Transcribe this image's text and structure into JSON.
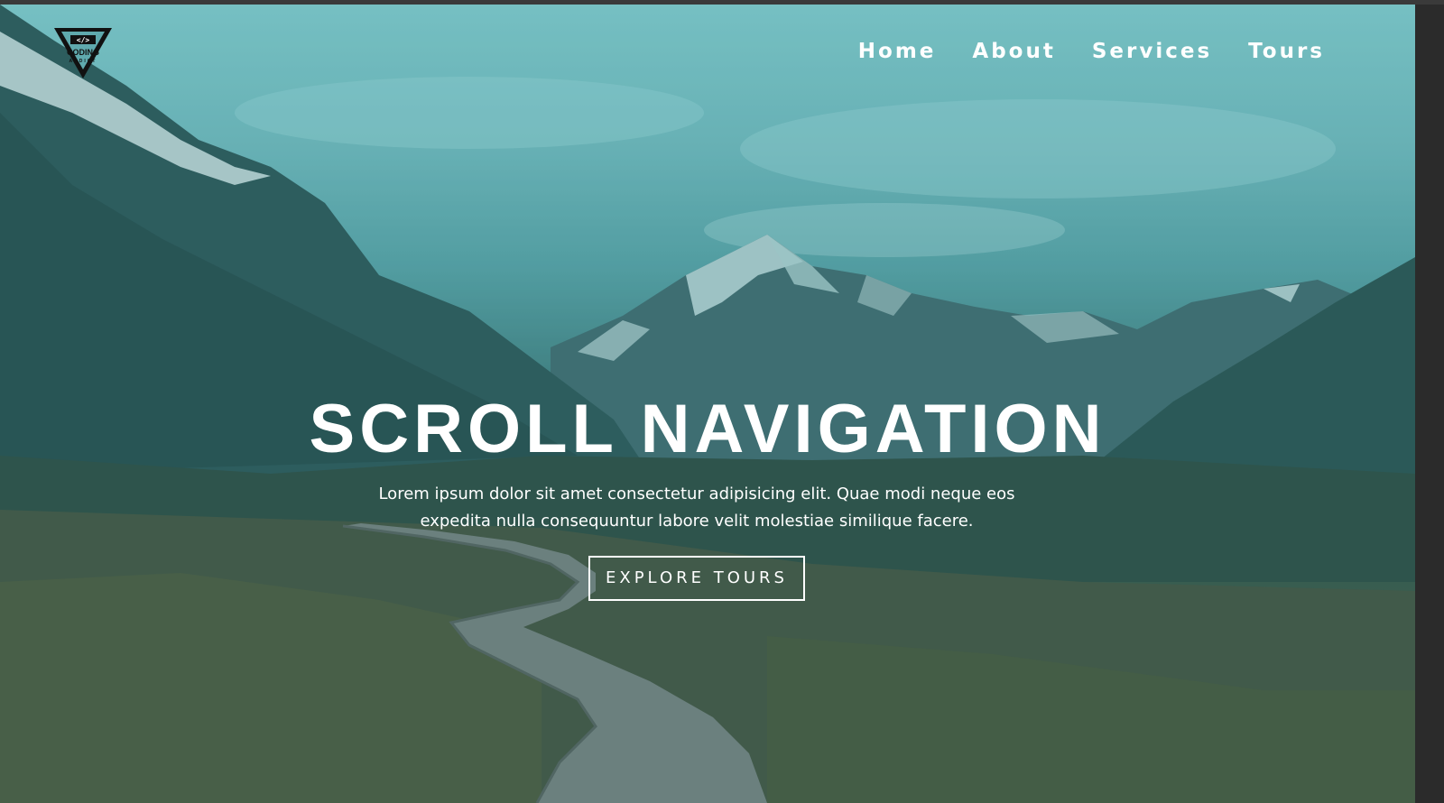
{
  "logo": {
    "text_main": "CODING",
    "text_sub": "ADDICT"
  },
  "nav": {
    "items": [
      {
        "label": "Home"
      },
      {
        "label": "About"
      },
      {
        "label": "Services"
      },
      {
        "label": "Tours"
      }
    ]
  },
  "hero": {
    "title": "SCROLL NAVIGATION",
    "description": "Lorem ipsum dolor sit amet consectetur adipisicing elit. Quae modi neque eos expedita nulla consequuntur labore velit molestiae similique facere.",
    "button_label": "EXPLORE TOURS"
  },
  "colors": {
    "overlay_tint": "#1e6e73",
    "text": "#ffffff"
  }
}
